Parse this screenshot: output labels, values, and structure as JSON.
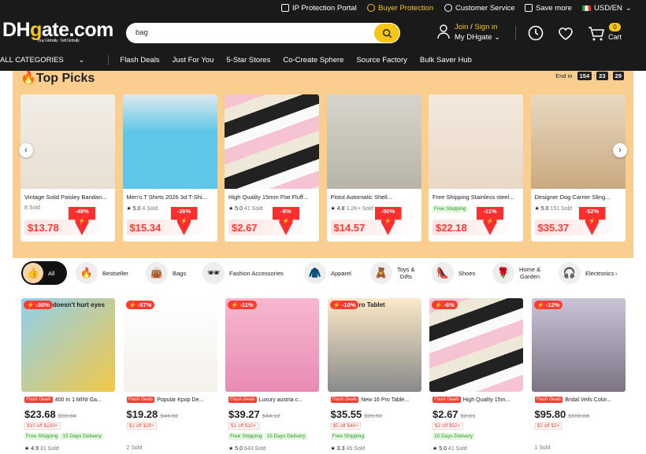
{
  "header": {
    "util": {
      "ip": "IP Protection Portal",
      "buyer": "Buyer Protection",
      "cs": "Customer Service",
      "save": "Save more",
      "locale": "USD/EN"
    },
    "logo": {
      "dh": "DH",
      "g": "g",
      "rest": "ate.com",
      "tagline": "Buy Globally · Sell Globally"
    },
    "search": {
      "query": "bag"
    },
    "account": {
      "join": "Join",
      "slash": " / ",
      "signin": "Sign in",
      "my": "My DHgate"
    },
    "cart": {
      "count": "0",
      "label": "Cart"
    },
    "nav": [
      "ALL CATEGORIES",
      "Flash Deals",
      "Just For You",
      "5-Star Stores",
      "Co-Create Sphere",
      "Source Factory",
      "Bulk Saver Hub"
    ]
  },
  "top_picks": {
    "title": "Top Picks",
    "end_in": "End in",
    "timer": [
      "154",
      "23",
      "29"
    ],
    "items": [
      {
        "title": "Vintage Solid Paisley Bandan...",
        "rating": "",
        "sold": "8 Sold",
        "price": "$13.78",
        "discount": "-48%",
        "free_ship": ""
      },
      {
        "title": "Men's T Shirts 2026 3d T-Shi...",
        "rating": "5.0",
        "sold": "4 Sold",
        "price": "$15.34",
        "discount": "-36%",
        "free_ship": ""
      },
      {
        "title": "High Quality 15mm Flat Fluff...",
        "rating": "5.0",
        "sold": "41 Sold",
        "price": "$2.67",
        "discount": "-6%",
        "free_ship": ""
      },
      {
        "title": "Pistol Automatic Shell...",
        "rating": "4.8",
        "sold": "1.2K+ Sold",
        "price": "$14.57",
        "discount": "-50%",
        "free_ship": ""
      },
      {
        "title": "Free Shipping Stainless steel...",
        "rating": "",
        "sold": "",
        "price": "$22.18",
        "discount": "-11%",
        "free_ship": "Free Shipping"
      },
      {
        "title": "Designer Dog Carrier Sling...",
        "rating": "5.0",
        "sold": "151 Sold",
        "price": "$35.37",
        "discount": "-52%",
        "free_ship": ""
      }
    ]
  },
  "categories": [
    {
      "label": "All",
      "icon": "thumbs-up-icon"
    },
    {
      "label": "Bestseller",
      "icon": "fire-icon"
    },
    {
      "label": "Bags",
      "icon": "bag-icon"
    },
    {
      "label": "Fashion Accessories",
      "icon": "sunglasses-icon"
    },
    {
      "label": "Apparel",
      "icon": "jacket-icon"
    },
    {
      "label": "Toys &",
      "label2": "Gifts",
      "icon": "toy-icon"
    },
    {
      "label": "Shoes",
      "icon": "shoe-icon"
    },
    {
      "label": "Home &",
      "label2": "Garden",
      "icon": "rose-icon"
    },
    {
      "label": "Electronics",
      "icon": "headphone-icon"
    }
  ],
  "grid": [
    {
      "tag": "-30%",
      "flash": "Flash Deals",
      "title": "400 In 1 MINI Ga...",
      "price": "$23.68",
      "orig": "$33.84",
      "coupon": "$10 off $100+",
      "badges": [
        "Free Shipping",
        "15 Days Delivery"
      ],
      "rating": "4.9",
      "sold": "31 Sold",
      "overlay": "doesn't hurt eyes"
    },
    {
      "tag": "-57%",
      "flash": "Flash Deals",
      "title": "Popular Kpop De...",
      "price": "$19.28",
      "orig": "$44.82",
      "coupon": "$1 off $20+",
      "badges": [],
      "rating": "",
      "sold": "2 Sold",
      "overlay": ""
    },
    {
      "tag": "-11%",
      "flash": "Flash Deals",
      "title": "Luxury austria c...",
      "price": "$39.27",
      "orig": "$44.12",
      "coupon": "$1 off $10+",
      "badges": [
        "Free Shipping",
        "15 Days Delivery"
      ],
      "rating": "5.0",
      "sold": "643 Sold",
      "overlay": ""
    },
    {
      "tag": "-10%",
      "flash": "Flash Deals",
      "title": "New 16 Pro Table...",
      "price": "$35.55",
      "orig": "$39.50",
      "coupon": "$5 off $40+",
      "badges": [
        "Free Shipping"
      ],
      "rating": "3.3",
      "sold": "45 Sold",
      "overlay": "ro Tablet"
    },
    {
      "tag": "-6%",
      "flash": "Flash Deals",
      "title": "High Quality 15m...",
      "price": "$2.67",
      "orig": "$2.81",
      "coupon": "$2 off $52+",
      "badges": [
        "15 Days Delivery"
      ],
      "rating": "5.0",
      "sold": "41 Sold",
      "overlay": ""
    },
    {
      "tag": "-12%",
      "flash": "Flash Deals",
      "title": "Bridal Veils Color...",
      "price": "$95.80",
      "orig": "$108.86",
      "coupon": "$2 off $3+",
      "badges": [],
      "rating": "",
      "sold": "1 Sold",
      "overlay": ""
    }
  ]
}
